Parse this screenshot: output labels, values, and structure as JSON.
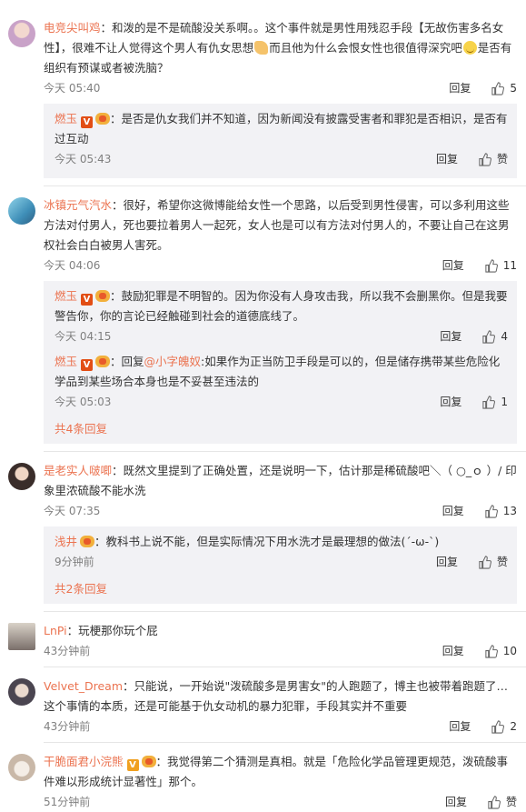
{
  "ui": {
    "reply": "回复",
    "like": "赞"
  },
  "comments": [
    {
      "user": "电竞尖叫鸡",
      "text_a": "：和泼的是不是硫酸没关系啊。。这个事件就是男性用残忍手段【无故伤害多名女性】，很难不让人觉得这个男人有仇女思想",
      "text_b": "而且他为什么会恨女性也很值得深究吧",
      "text_c": "是否有组织有预谋或者被洗脑？",
      "time": "今天 05:40",
      "likes": "5",
      "replies": [
        {
          "user": "燃玉",
          "text": "：是否是仇女我们并不知道，因为新闻没有披露受害者和罪犯是否相识，是否有过互动",
          "time": "今天 05:43",
          "likes": "赞"
        }
      ]
    },
    {
      "user": "冰镇元气汽水",
      "text": "：很好，希望你这微博能给女性一个思路，以后受到男性侵害，可以多利用这些方法对付男人，死也要拉着男人一起死，女人也是可以有方法对付男人的，不要让自己在这男权社会白白被男人害死。",
      "time": "今天 04:06",
      "likes": "11",
      "replies": [
        {
          "user": "燃玉",
          "text": "：鼓励犯罪是不明智的。因为你没有人身攻击我，所以我不会删黑你。但是我要警告你，你的言论已经触碰到社会的道德底线了。",
          "time": "今天 04:15",
          "likes": "4"
        },
        {
          "user": "燃玉",
          "prefix": "：回复",
          "mention": "@小字魄奴",
          "text": ":如果作为正当防卫手段是可以的，但是储存携带某些危险化学品到某些场合本身也是不妥甚至违法的",
          "time": "今天 05:03",
          "likes": "1"
        }
      ],
      "more": "共4条回复"
    },
    {
      "user": "是老实人啵唧",
      "text": "：既然文里提到了正确处置，还是说明一下，估计那是稀硫酸吧＼（ ○_ｏ ）/ 印象里浓硫酸不能水洗",
      "time": "今天 07:35",
      "likes": "13",
      "replies": [
        {
          "user": "浅井",
          "text": "：教科书上说不能，但是实际情况下用水洗才是最理想的做法(´-ω-`)",
          "time": "9分钟前",
          "likes": "赞"
        }
      ],
      "more": "共2条回复"
    },
    {
      "user": "LnPi",
      "text": "：玩梗那你玩个屁",
      "time": "43分钟前",
      "likes": "10"
    },
    {
      "user": "Velvet_Dream",
      "text": "：只能说，一开始说\"泼硫酸多是男害女\"的人跑题了，博主也被带着跑题了…这个事情的本质，还是可能基于仇女动机的暴力犯罪，手段其实并不重要",
      "time": "43分钟前",
      "likes": "2"
    },
    {
      "user": "干脆面君小浣熊",
      "text": "：我觉得第二个猜测是真相。就是「危险化学品管理更规范，泼硫酸事件难以形成统计显著性」那个。",
      "time": "51分钟前",
      "likes": "赞"
    }
  ],
  "colors": {
    "username": "#eb7350",
    "meta": "#808080",
    "subbg": "#f2f2f5"
  }
}
